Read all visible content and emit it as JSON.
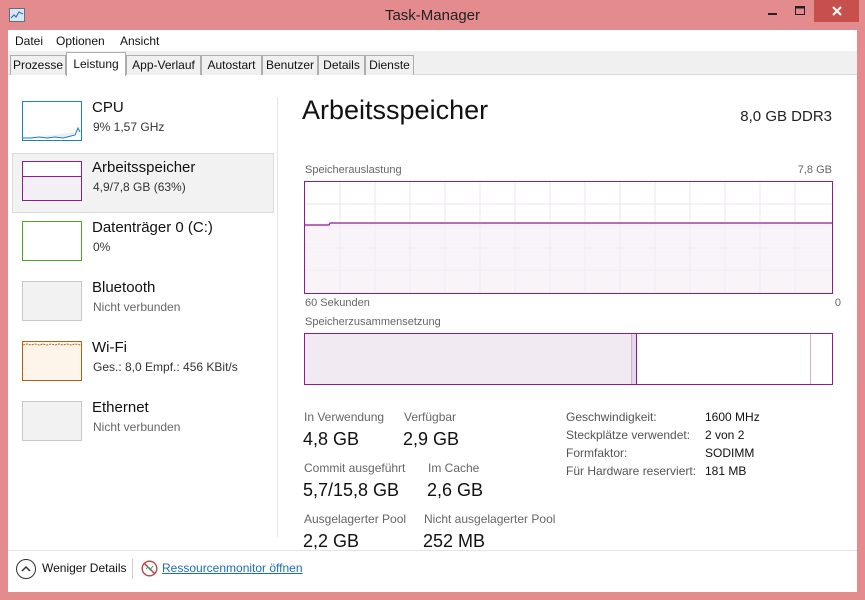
{
  "window": {
    "title": "Task-Manager"
  },
  "menu": [
    "Datei",
    "Optionen",
    "Ansicht"
  ],
  "tabs": [
    "Prozesse",
    "Leistung",
    "App-Verlauf",
    "Autostart",
    "Benutzer",
    "Details",
    "Dienste"
  ],
  "active_tab": "Leistung",
  "sidebar": {
    "items": [
      {
        "title": "CPU",
        "sub": "9%  1,57 GHz",
        "color": "#1f7fc4"
      },
      {
        "title": "Arbeitsspeicher",
        "sub": "4,9/7,8 GB (63%)",
        "color": "#8b1e8e",
        "selected": true,
        "usage_fraction": 0.63
      },
      {
        "title": "Datenträger 0 (C:)",
        "sub": "0%",
        "color": "#4ca427"
      },
      {
        "title": "Bluetooth",
        "sub": "Nicht verbunden",
        "color": "#c8c8c8"
      },
      {
        "title": "Wi-Fi",
        "sub": "Ges.: 8,0  Empf.: 456 KBit/s",
        "color": "#b65f17"
      },
      {
        "title": "Ethernet",
        "sub": "Nicht verbunden",
        "color": "#c8c8c8"
      }
    ]
  },
  "main": {
    "title": "Arbeitsspeicher",
    "spec": "8,0 GB DDR3",
    "usage_graph": {
      "label": "Speicherauslastung",
      "max_label": "7,8 GB",
      "time_label": "60 Sekunden",
      "zero_label": "0",
      "fill_fraction": 0.63
    },
    "composition": {
      "label": "Speicherzusammensetzung",
      "in_use_fraction": 0.62,
      "modified_fraction": 0.01,
      "standby_fraction": 0.33
    },
    "stats": [
      {
        "label": "In Verwendung",
        "value": "4,8 GB"
      },
      {
        "label": "Verfügbar",
        "value": "2,9 GB"
      },
      {
        "label": "Commit ausgeführt",
        "value": "5,7/15,8 GB"
      },
      {
        "label": "Im Cache",
        "value": "2,6 GB"
      },
      {
        "label": "Ausgelagerter Pool",
        "value": "2,2 GB"
      },
      {
        "label": "Nicht ausgelagerter Pool",
        "value": "252 MB"
      }
    ],
    "details": [
      {
        "label": "Geschwindigkeit:",
        "value": "1600 MHz"
      },
      {
        "label": "Steckplätze verwendet:",
        "value": "2 von 2"
      },
      {
        "label": "Formfaktor:",
        "value": "SODIMM"
      },
      {
        "label": "Für Hardware reserviert:",
        "value": "181 MB"
      }
    ]
  },
  "footer": {
    "fewer_details": "Weniger Details",
    "resource_monitor": "Ressourcenmonitor öffnen"
  }
}
